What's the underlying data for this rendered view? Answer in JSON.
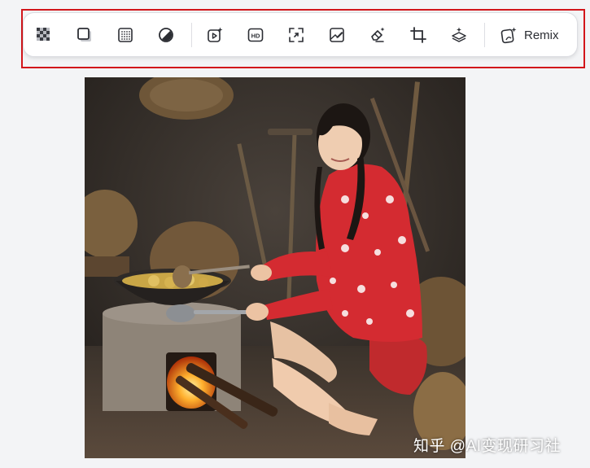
{
  "toolbar": {
    "remix_label": "Remix",
    "tools": [
      {
        "name": "transparent-background-tool",
        "icon": "checkerboard-icon"
      },
      {
        "name": "add-shadow-tool",
        "icon": "shadow-square-icon"
      },
      {
        "name": "pattern-background-tool",
        "icon": "grid-square-icon"
      },
      {
        "name": "adjust-tool",
        "icon": "contrast-circle-icon"
      },
      {
        "name": "image-to-video-tool",
        "icon": "play-sparkle-icon"
      },
      {
        "name": "upscale-hd-tool",
        "icon": "hd-icon"
      },
      {
        "name": "expand-tool",
        "icon": "expand-corners-icon"
      },
      {
        "name": "edit-image-tool",
        "icon": "image-edit-icon"
      },
      {
        "name": "erase-tool",
        "icon": "eraser-sparkle-icon"
      },
      {
        "name": "crop-tool",
        "icon": "crop-icon"
      },
      {
        "name": "layers-tool",
        "icon": "layers-sparkle-icon"
      }
    ],
    "remix_icon": "remix-sparkle-icon"
  },
  "highlight_color": "#d2161b",
  "watermark": {
    "text": "知乎 @AI变现研习社"
  }
}
